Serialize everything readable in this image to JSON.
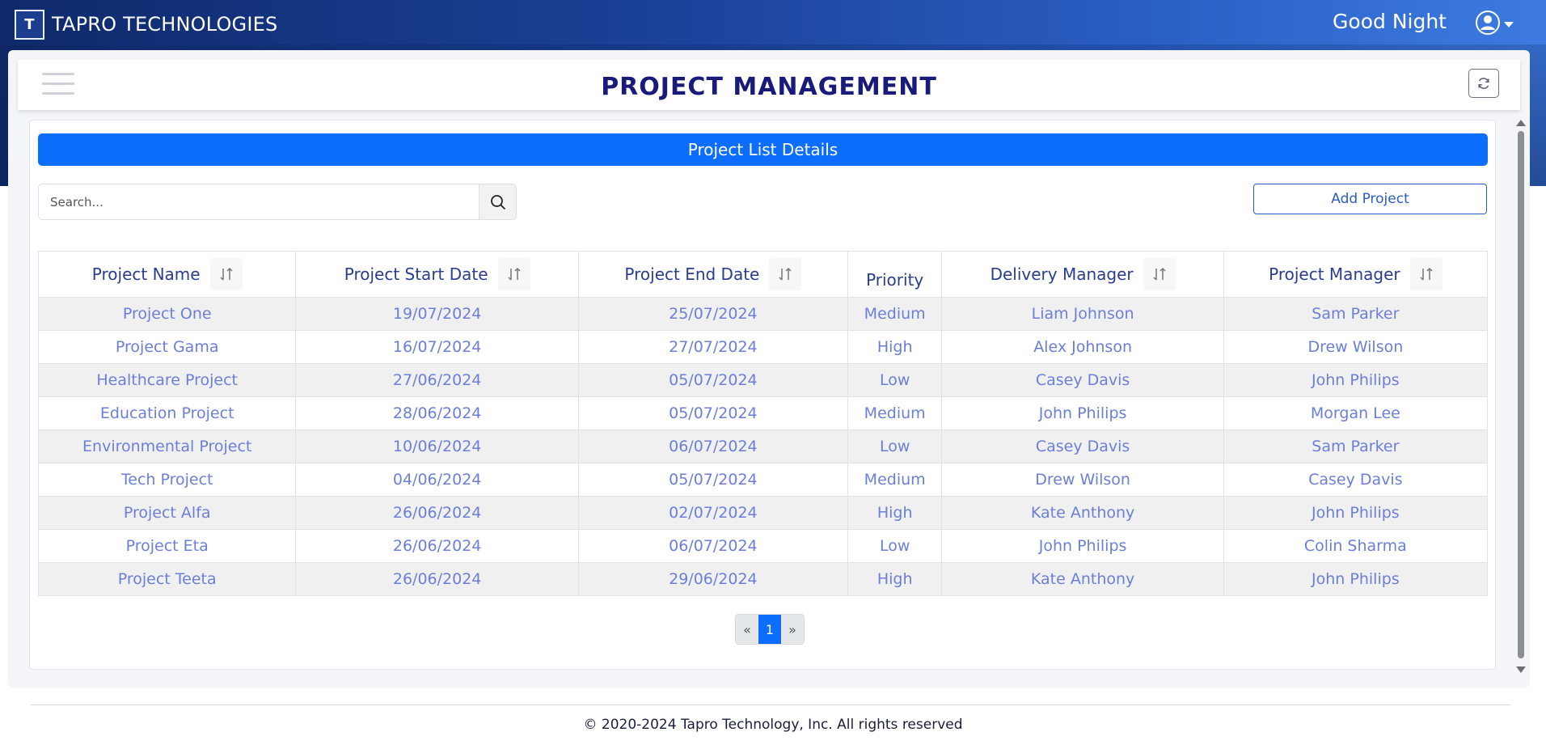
{
  "brand": {
    "name": "TAPRO TECHNOLOGIES",
    "logo_text": "T"
  },
  "header": {
    "greeting": "Good Night"
  },
  "page": {
    "title": "PROJECT MANAGEMENT"
  },
  "section": {
    "title": "Project List Details"
  },
  "search": {
    "placeholder": "Search...",
    "value": ""
  },
  "actions": {
    "add_project": "Add Project"
  },
  "table": {
    "columns": [
      {
        "label": "Project Name",
        "sortable": true
      },
      {
        "label": "Project Start Date",
        "sortable": true
      },
      {
        "label": "Project End Date",
        "sortable": true
      },
      {
        "label": "Priority",
        "sortable": false
      },
      {
        "label": "Delivery Manager",
        "sortable": true
      },
      {
        "label": "Project Manager",
        "sortable": true
      }
    ],
    "rows": [
      [
        "Project One",
        "19/07/2024",
        "25/07/2024",
        "Medium",
        "Liam Johnson",
        "Sam Parker"
      ],
      [
        "Project Gama",
        "16/07/2024",
        "27/07/2024",
        "High",
        "Alex Johnson",
        "Drew Wilson"
      ],
      [
        "Healthcare Project",
        "27/06/2024",
        "05/07/2024",
        "Low",
        "Casey Davis",
        "John Philips"
      ],
      [
        "Education Project",
        "28/06/2024",
        "05/07/2024",
        "Medium",
        "John Philips",
        "Morgan Lee"
      ],
      [
        "Environmental Project",
        "10/06/2024",
        "06/07/2024",
        "Low",
        "Casey Davis",
        "Sam Parker"
      ],
      [
        "Tech Project",
        "04/06/2024",
        "05/07/2024",
        "Medium",
        "Drew Wilson",
        "Casey Davis"
      ],
      [
        "Project Alfa",
        "26/06/2024",
        "02/07/2024",
        "High",
        "Kate Anthony",
        "John Philips"
      ],
      [
        "Project Eta",
        "26/06/2024",
        "06/07/2024",
        "Low",
        "John Philips",
        "Colin Sharma"
      ],
      [
        "Project Teeta",
        "26/06/2024",
        "29/06/2024",
        "High",
        "Kate Anthony",
        "John Philips"
      ]
    ]
  },
  "pagination": {
    "prev": "«",
    "current": "1",
    "next": "»"
  },
  "footer": {
    "copyright": "© 2020-2024 Tapro Technology, Inc. All rights reserved"
  },
  "colors": {
    "accent": "#0d6efd",
    "title": "#1a1a7a",
    "cell_text": "#6c7fd8",
    "header_text": "#2a3d8f"
  }
}
